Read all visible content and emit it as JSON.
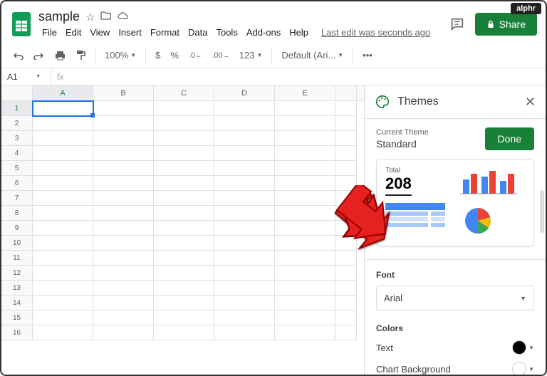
{
  "watermark": "alphr",
  "doc": {
    "title": "sample",
    "last_edit": "Last edit was seconds ago"
  },
  "menus": [
    "File",
    "Edit",
    "View",
    "Insert",
    "Format",
    "Data",
    "Tools",
    "Add-ons",
    "Help"
  ],
  "share_label": "Share",
  "toolbar": {
    "zoom": "100%",
    "currency": "$",
    "percent": "%",
    "dec_dec": ".0",
    "dec_inc": ".00",
    "more_fmt": "123",
    "font": "Default (Ari...",
    "more": "•••"
  },
  "name_box": "A1",
  "fx_label": "fx",
  "columns": [
    "A",
    "B",
    "C",
    "D",
    "E"
  ],
  "row_count": 16,
  "panel": {
    "title": "Themes",
    "current_label": "Current Theme",
    "current_name": "Standard",
    "done": "Done",
    "preview_total_label": "Total",
    "preview_total_value": "208",
    "font_section": "Font",
    "font_value": "Arial",
    "colors_section": "Colors",
    "color_text_label": "Text",
    "color_text_value": "#000000",
    "color_bg_label": "Chart Background",
    "color_bg_value": "#ffffff"
  }
}
